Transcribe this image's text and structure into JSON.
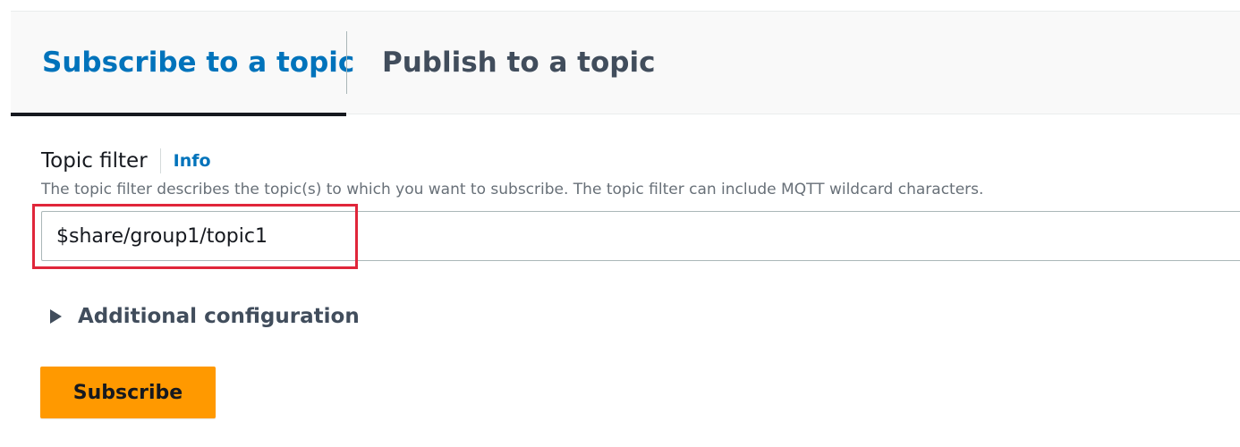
{
  "tabs": {
    "subscribe_label": "Subscribe to a topic",
    "publish_label": "Publish to a topic",
    "active": "subscribe"
  },
  "topic_filter": {
    "label": "Topic filter",
    "info_link": "Info",
    "description": "The topic filter describes the topic(s) to which you want to subscribe. The topic filter can include MQTT wildcard characters.",
    "value": "$share/group1/topic1"
  },
  "additional_config": {
    "label": "Additional configuration",
    "icon": "caret-right-icon",
    "expanded": false
  },
  "actions": {
    "subscribe_label": "Subscribe"
  },
  "colors": {
    "link": "#0073bb",
    "primary_button": "#ff9900",
    "highlight": "#e0263a"
  }
}
